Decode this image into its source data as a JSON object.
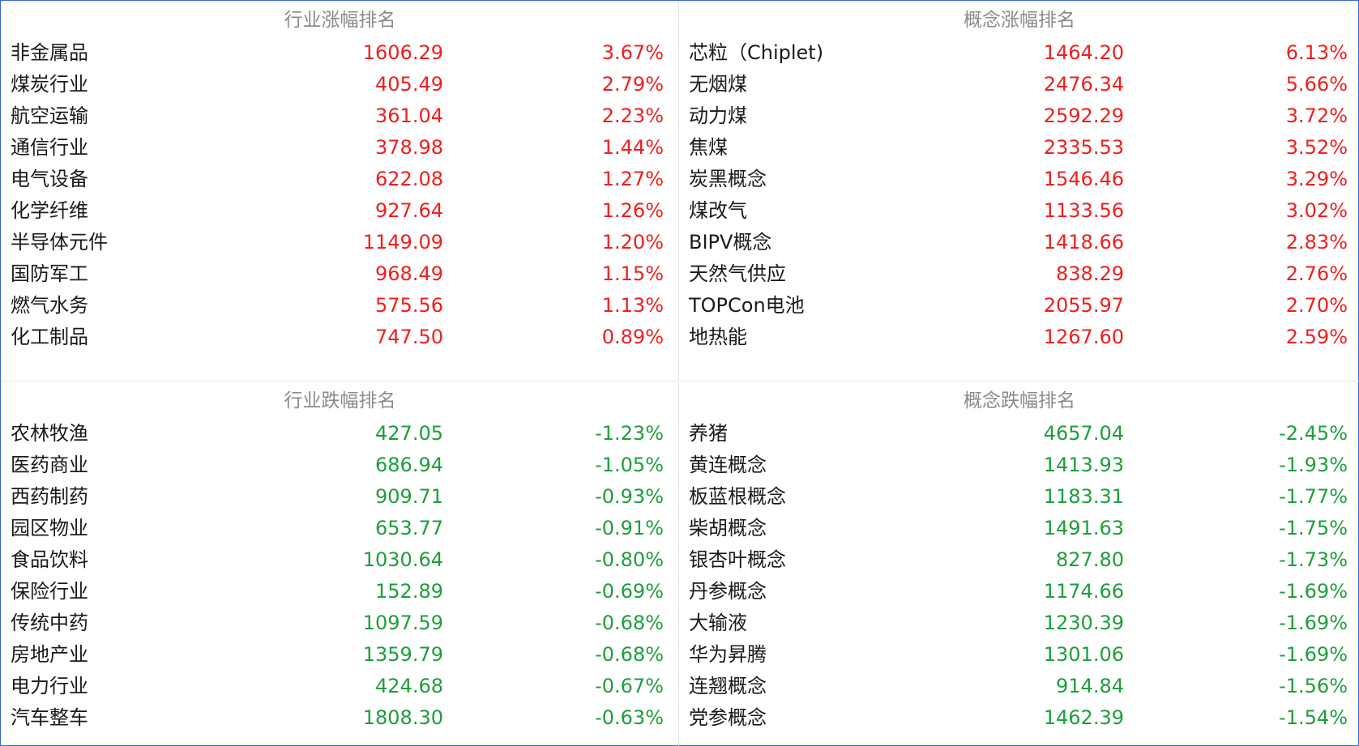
{
  "colors": {
    "up": "#f01e1e",
    "down": "#1e9e3c",
    "title": "#8a8a8a",
    "border": "#3a64d8"
  },
  "industry_gainers": {
    "title": "行业涨幅排名",
    "rows": [
      {
        "name": "非金属品",
        "price": "1606.29",
        "pct": "3.67%"
      },
      {
        "name": "煤炭行业",
        "price": "405.49",
        "pct": "2.79%"
      },
      {
        "name": "航空运输",
        "price": "361.04",
        "pct": "2.23%"
      },
      {
        "name": "通信行业",
        "price": "378.98",
        "pct": "1.44%"
      },
      {
        "name": "电气设备",
        "price": "622.08",
        "pct": "1.27%"
      },
      {
        "name": "化学纤维",
        "price": "927.64",
        "pct": "1.26%"
      },
      {
        "name": "半导体元件",
        "price": "1149.09",
        "pct": "1.20%"
      },
      {
        "name": "国防军工",
        "price": "968.49",
        "pct": "1.15%"
      },
      {
        "name": "燃气水务",
        "price": "575.56",
        "pct": "1.13%"
      },
      {
        "name": "化工制品",
        "price": "747.50",
        "pct": "0.89%"
      }
    ]
  },
  "concept_gainers": {
    "title": "概念涨幅排名",
    "rows": [
      {
        "name": "芯粒（Chiplet)",
        "price": "1464.20",
        "pct": "6.13%"
      },
      {
        "name": "无烟煤",
        "price": "2476.34",
        "pct": "5.66%"
      },
      {
        "name": "动力煤",
        "price": "2592.29",
        "pct": "3.72%"
      },
      {
        "name": "焦煤",
        "price": "2335.53",
        "pct": "3.52%"
      },
      {
        "name": "炭黑概念",
        "price": "1546.46",
        "pct": "3.29%"
      },
      {
        "name": "煤改气",
        "price": "1133.56",
        "pct": "3.02%"
      },
      {
        "name": "BIPV概念",
        "price": "1418.66",
        "pct": "2.83%"
      },
      {
        "name": "天然气供应",
        "price": "838.29",
        "pct": "2.76%"
      },
      {
        "name": "TOPCon电池",
        "price": "2055.97",
        "pct": "2.70%"
      },
      {
        "name": "地热能",
        "price": "1267.60",
        "pct": "2.59%"
      }
    ]
  },
  "industry_losers": {
    "title": "行业跌幅排名",
    "rows": [
      {
        "name": "农林牧渔",
        "price": "427.05",
        "pct": "-1.23%"
      },
      {
        "name": "医药商业",
        "price": "686.94",
        "pct": "-1.05%"
      },
      {
        "name": "西药制药",
        "price": "909.71",
        "pct": "-0.93%"
      },
      {
        "name": "园区物业",
        "price": "653.77",
        "pct": "-0.91%"
      },
      {
        "name": "食品饮料",
        "price": "1030.64",
        "pct": "-0.80%"
      },
      {
        "name": "保险行业",
        "price": "152.89",
        "pct": "-0.69%"
      },
      {
        "name": "传统中药",
        "price": "1097.59",
        "pct": "-0.68%"
      },
      {
        "name": "房地产业",
        "price": "1359.79",
        "pct": "-0.68%"
      },
      {
        "name": "电力行业",
        "price": "424.68",
        "pct": "-0.67%"
      },
      {
        "name": "汽车整车",
        "price": "1808.30",
        "pct": "-0.63%"
      }
    ]
  },
  "concept_losers": {
    "title": "概念跌幅排名",
    "rows": [
      {
        "name": "养猪",
        "price": "4657.04",
        "pct": "-2.45%"
      },
      {
        "name": "黄连概念",
        "price": "1413.93",
        "pct": "-1.93%"
      },
      {
        "name": "板蓝根概念",
        "price": "1183.31",
        "pct": "-1.77%"
      },
      {
        "name": "柴胡概念",
        "price": "1491.63",
        "pct": "-1.75%"
      },
      {
        "name": "银杏叶概念",
        "price": "827.80",
        "pct": "-1.73%"
      },
      {
        "name": "丹参概念",
        "price": "1174.66",
        "pct": "-1.69%"
      },
      {
        "name": "大输液",
        "price": "1230.39",
        "pct": "-1.69%"
      },
      {
        "name": "华为昇腾",
        "price": "1301.06",
        "pct": "-1.69%"
      },
      {
        "name": "连翘概念",
        "price": "914.84",
        "pct": "-1.56%"
      },
      {
        "name": "党参概念",
        "price": "1462.39",
        "pct": "-1.54%"
      }
    ]
  }
}
